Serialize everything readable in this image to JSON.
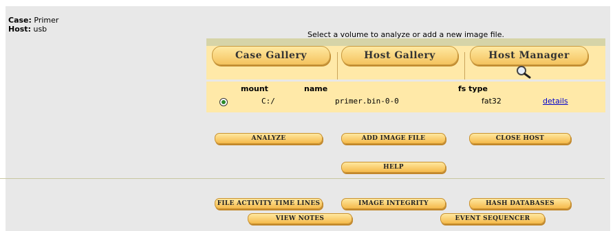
{
  "case": {
    "label": "Case:",
    "value": "Primer"
  },
  "host": {
    "label": "Host:",
    "value": "usb"
  },
  "instructions": "Select a volume to analyze or add a new image file.",
  "gallery_tabs": {
    "case_gallery": "Case Gallery",
    "host_gallery": "Host Gallery",
    "host_manager": "Host Manager"
  },
  "volume_table": {
    "headers": {
      "mount": "mount",
      "name": "name",
      "fs_type": "fs type"
    },
    "rows": [
      {
        "mount": "C:/",
        "name": "primer.bin-0-0",
        "fs_type": "fat32",
        "details": "details",
        "selected": true
      }
    ]
  },
  "buttons": {
    "analyze": "Analyze",
    "add_image_file": "Add Image File",
    "close_host": "Close Host",
    "help": "Help",
    "file_activity_time_lines": "File Activity Time Lines",
    "image_integrity": "Image Integrity",
    "hash_databases": "Hash Databases",
    "view_notes": "View Notes",
    "event_sequencer": "Event Sequencer"
  }
}
